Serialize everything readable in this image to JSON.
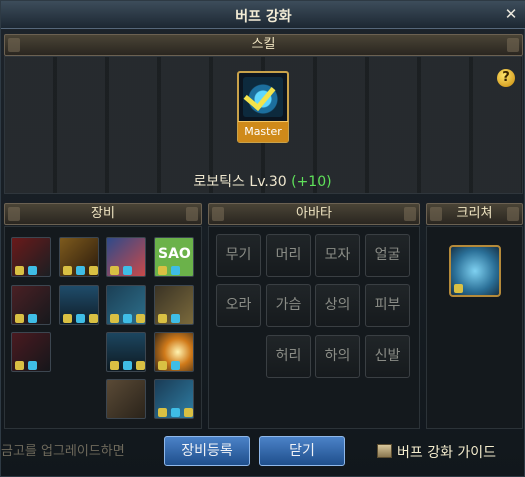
{
  "window": {
    "title": "버프 강화",
    "close": "✕"
  },
  "skill": {
    "header": "스킬",
    "badge": "Master",
    "name": "로보틱스 Lv.30",
    "bonus": "(+10)",
    "help": "?"
  },
  "equipment": {
    "header": "장비",
    "slots": [
      "sao-icon",
      "helmet-icon",
      "gear-icon",
      "weapon-icon"
    ]
  },
  "avatar": {
    "header": "아바타",
    "cells": [
      [
        "무기",
        "머리",
        "모자",
        "얼굴"
      ],
      [
        "오라",
        "가슴",
        "상의",
        "피부"
      ],
      [
        "",
        "허리",
        "하의",
        "신발"
      ]
    ]
  },
  "creature": {
    "header": "크리쳐"
  },
  "footer": {
    "notice": "금고를 업그레이드하면",
    "register": "장비등록",
    "close_btn": "닫기",
    "guide": "버프 강화 가이드"
  },
  "colors": {
    "bonus": "#5fe15a",
    "master": "#cf8a1a",
    "button": "#2f66aa"
  }
}
